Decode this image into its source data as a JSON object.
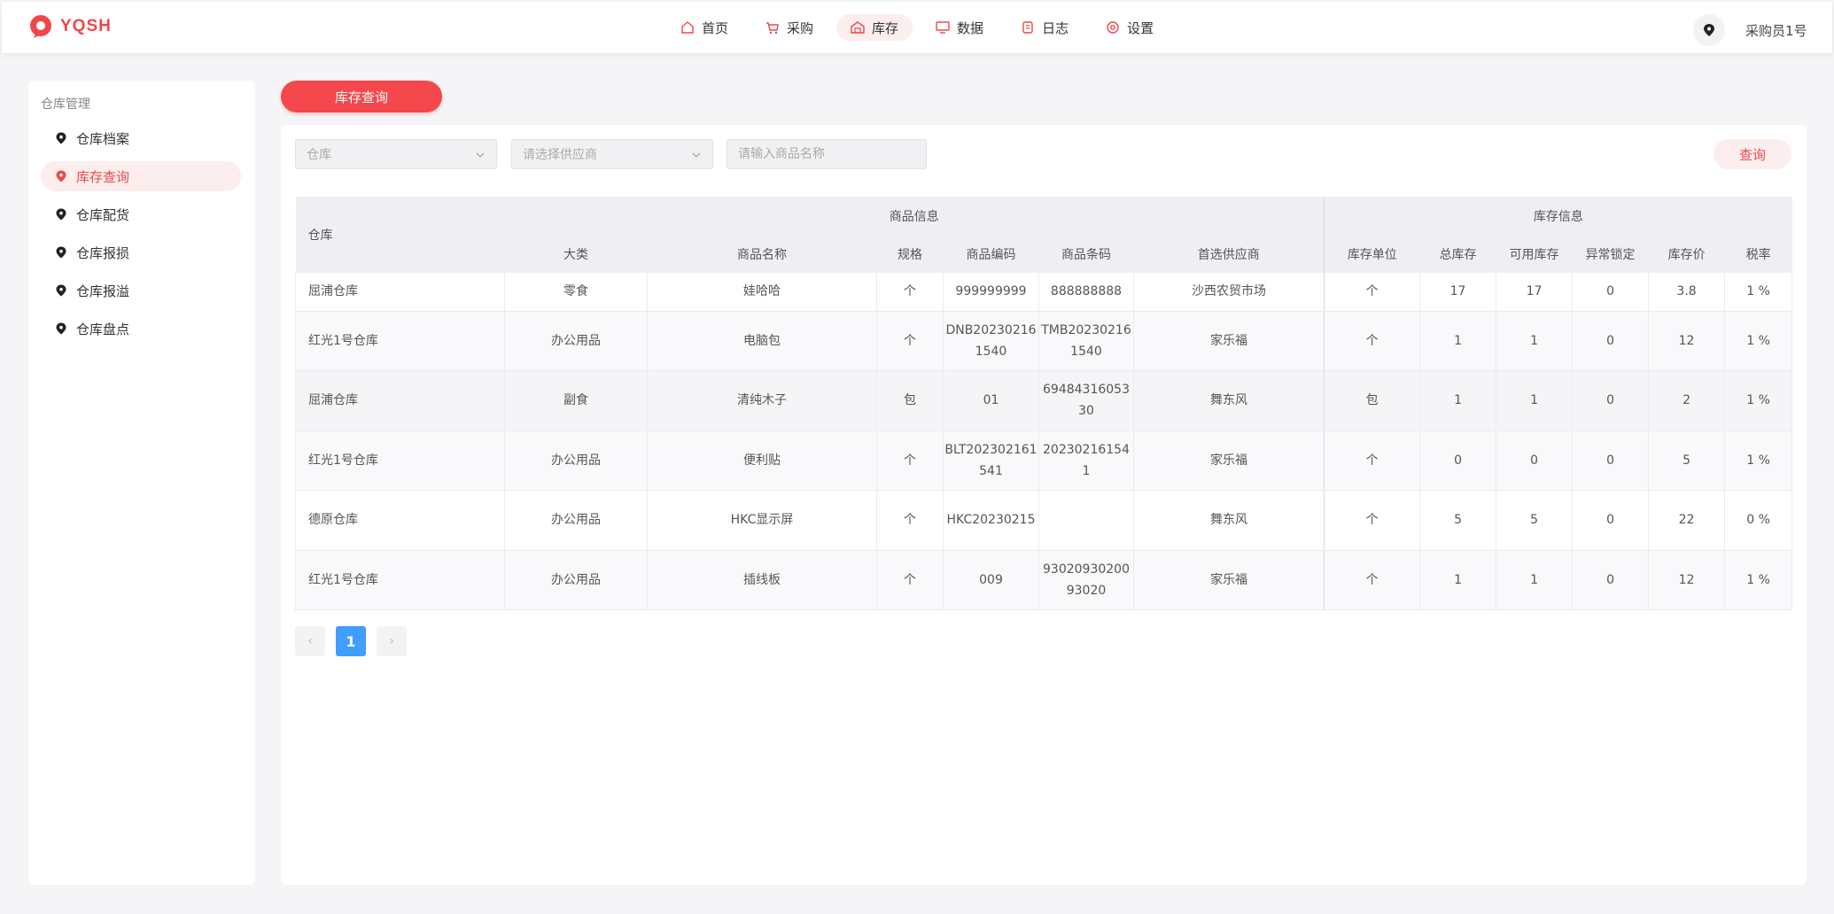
{
  "header": {
    "brand": "YQSH",
    "nav": [
      {
        "label": "首页",
        "icon": "home-icon"
      },
      {
        "label": "采购",
        "icon": "cart-icon"
      },
      {
        "label": "库存",
        "icon": "warehouse-icon",
        "active": true
      },
      {
        "label": "数据",
        "icon": "monitor-icon"
      },
      {
        "label": "日志",
        "icon": "log-icon"
      },
      {
        "label": "设置",
        "icon": "gear-icon"
      }
    ],
    "user": "采购员1号"
  },
  "sidebar": {
    "title": "仓库管理",
    "items": [
      {
        "label": "仓库档案"
      },
      {
        "label": "库存查询",
        "active": true
      },
      {
        "label": "仓库配货"
      },
      {
        "label": "仓库报损"
      },
      {
        "label": "仓库报溢"
      },
      {
        "label": "仓库盘点"
      }
    ]
  },
  "page_tab": "库存查询",
  "filters": {
    "warehouse_placeholder": "仓库",
    "supplier_placeholder": "请选择供应商",
    "product_placeholder": "请输入商品名称",
    "search_label": "查询"
  },
  "table": {
    "group_headers": {
      "warehouse": "仓库",
      "product_info": "商品信息",
      "stock_info": "库存信息"
    },
    "columns": [
      "大类",
      "商品名称",
      "规格",
      "商品编码",
      "商品条码",
      "首选供应商",
      "库存单位",
      "总库存",
      "可用库存",
      "异常锁定",
      "库存价",
      "税率"
    ],
    "rows": [
      [
        "屈浦仓库",
        "零食",
        "娃哈哈",
        "个",
        "999999999",
        "888888888",
        "沙西农贸市场",
        "个",
        "17",
        "17",
        "0",
        "3.8",
        "1 %"
      ],
      [
        "红光1号仓库",
        "办公用品",
        "电脑包",
        "个",
        "DNB202302161540",
        "TMB202302161540",
        "家乐福",
        "个",
        "1",
        "1",
        "0",
        "12",
        "1 %"
      ],
      [
        "屈浦仓库",
        "副食",
        "清纯木子",
        "包",
        "01",
        "6948431605330",
        "舞东风",
        "包",
        "1",
        "1",
        "0",
        "2",
        "1 %"
      ],
      [
        "红光1号仓库",
        "办公用品",
        "便利贴",
        "个",
        "BLT202302161541",
        "202302161541",
        "家乐福",
        "个",
        "0",
        "0",
        "0",
        "5",
        "1 %"
      ],
      [
        "德原仓库",
        "办公用品",
        "HKC显示屏",
        "个",
        "HKC20230215",
        "",
        "舞东风",
        "个",
        "5",
        "5",
        "0",
        "22",
        "0 %"
      ],
      [
        "红光1号仓库",
        "办公用品",
        "插线板",
        "个",
        "009",
        "9302093020093020",
        "家乐福",
        "个",
        "1",
        "1",
        "0",
        "12",
        "1 %"
      ]
    ]
  },
  "pagination": {
    "prev": "‹",
    "current": "1",
    "next": "›"
  },
  "colors": {
    "accent": "#f4484d",
    "accent_light": "#fdeeee",
    "page_active": "#409eff"
  }
}
